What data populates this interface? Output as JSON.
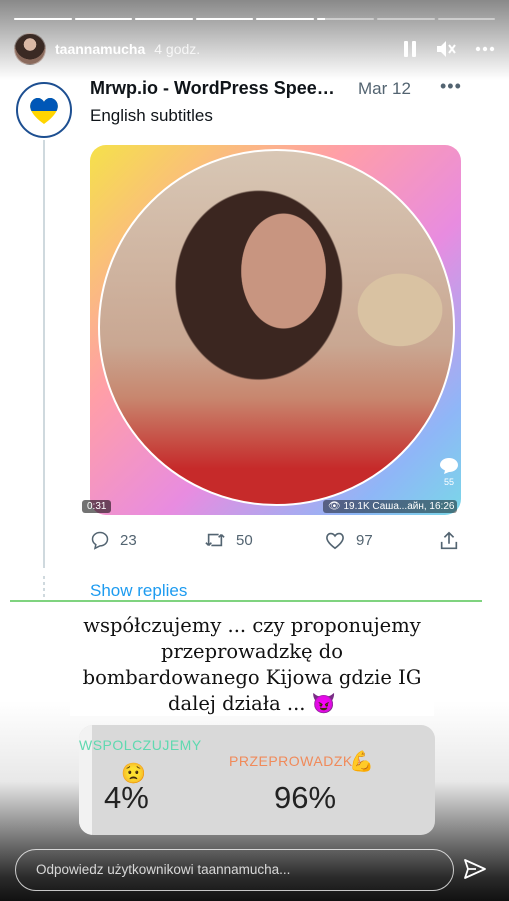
{
  "story": {
    "progress_segments": [
      1,
      1,
      1,
      1,
      1,
      0.15,
      0,
      0
    ],
    "username": "taannamucha",
    "time": "4 godz.",
    "reply_placeholder": "Odpowiedz użytkownikowi taannamucha..."
  },
  "tweet": {
    "display_name": "Mrwp.io - WordPress Speed...",
    "date": "Mar 12",
    "more": "•••",
    "text": "English subtitles",
    "avatar_text": "UKRAINE",
    "media_duration": "0:31",
    "media_views": "19.1K Саша...айн, 16:26",
    "media_comments": "55",
    "replies": "23",
    "retweets": "50",
    "likes": "97",
    "show_replies": "Show replies"
  },
  "caption": {
    "text": "współczujemy ... czy proponujemy przeprowadzkę do bombardowanego Kijowa gdzie IG dalej działa ... 😈"
  },
  "poll": {
    "option_a": "WSPOLCZUJEMY",
    "option_a_emoji": "😟",
    "option_a_percent": "4%",
    "option_b": "PRZEPROWADZKA",
    "option_b_emoji": "💪",
    "option_b_percent": "96%"
  },
  "colors": {
    "poll_a": "#5fd9b0",
    "poll_b": "#f08a5a",
    "link": "#1d9bf0",
    "divider": "#7fd37f"
  }
}
